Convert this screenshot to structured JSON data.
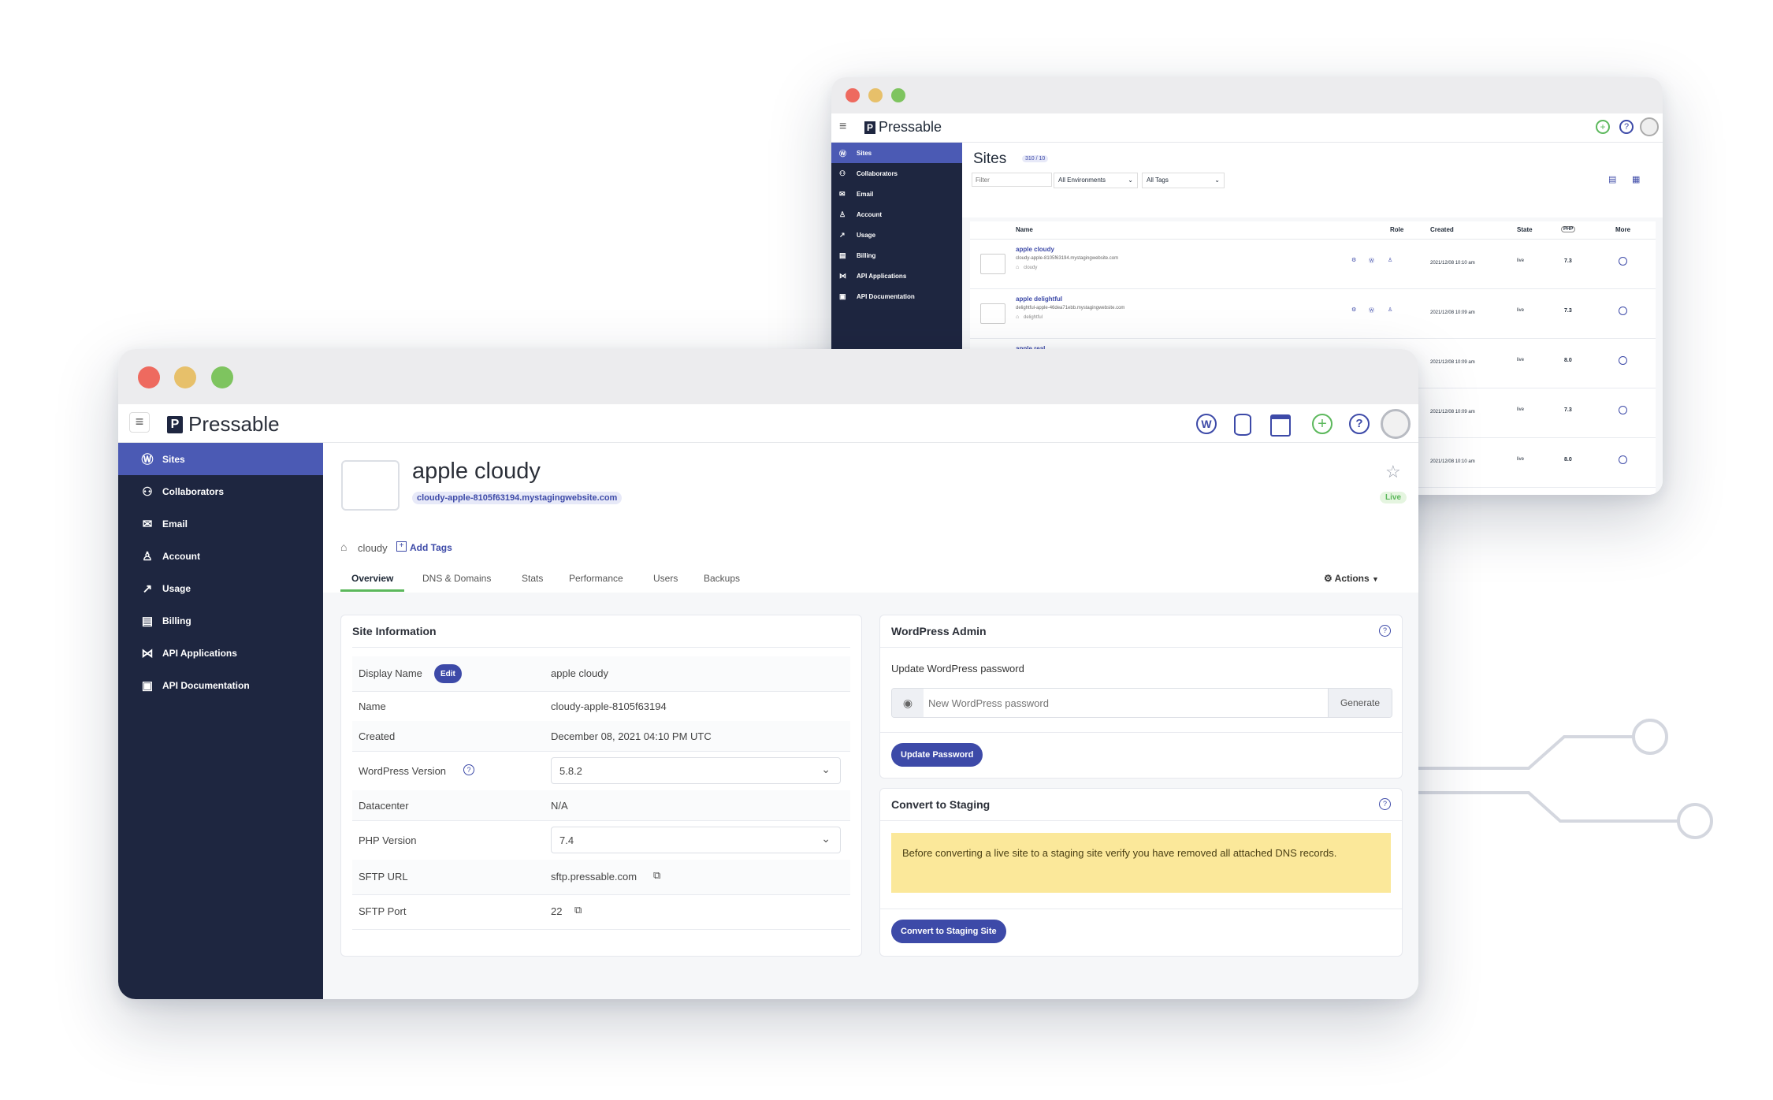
{
  "back_window": {
    "brand": "Pressable",
    "nav": [
      "Sites",
      "Collaborators",
      "Email",
      "Account",
      "Usage",
      "Billing",
      "API Applications",
      "API Documentation"
    ],
    "page_title": "Sites",
    "count_badge": "310 / 10",
    "filter_placeholder": "Filter",
    "env_select": "All Environments",
    "tags_select": "All Tags",
    "columns": [
      "Name",
      "Role",
      "Created",
      "State",
      "PHP",
      "More"
    ],
    "rows": [
      {
        "name": "apple cloudy",
        "url": "cloudy-apple-8105f63194.mystagingwebsite.com",
        "tag": "cloudy",
        "created": "2021/12/08 10:10 am",
        "state": "live",
        "php": "7.3"
      },
      {
        "name": "apple delightful",
        "url": "delightful-apple-46dea71ebb.mystagingwebsite.com",
        "tag": "delightful",
        "created": "2021/12/08 10:09 am",
        "state": "live",
        "php": "7.3"
      },
      {
        "name": "apple real",
        "url": "",
        "tag": "",
        "created": "2021/12/08 10:09 am",
        "state": "live",
        "php": "8.0"
      },
      {
        "name": "",
        "url": "",
        "tag": "",
        "created": "2021/12/08 10:09 am",
        "state": "live",
        "php": "7.3"
      },
      {
        "name": "",
        "url": "",
        "tag": "",
        "created": "2021/12/08 10:10 am",
        "state": "live",
        "php": "8.0"
      }
    ]
  },
  "front_window": {
    "brand": "Pressable",
    "nav": [
      "Sites",
      "Collaborators",
      "Email",
      "Account",
      "Usage",
      "Billing",
      "API Applications",
      "API Documentation"
    ],
    "site_title": "apple cloudy",
    "site_url": "cloudy-apple-8105f63194.mystagingwebsite.com",
    "status": "Live",
    "tag": "cloudy",
    "add_tags": "Add Tags",
    "tabs": [
      "Overview",
      "DNS & Domains",
      "Stats",
      "Performance",
      "Users",
      "Backups"
    ],
    "actions": "Actions",
    "site_info": {
      "heading": "Site Information",
      "edit": "Edit",
      "rows": [
        {
          "label": "Display Name",
          "value": "apple cloudy"
        },
        {
          "label": "Name",
          "value": "cloudy-apple-8105f63194"
        },
        {
          "label": "Created",
          "value": "December 08, 2021 04:10 PM UTC"
        },
        {
          "label": "WordPress Version",
          "value": "5.8.2"
        },
        {
          "label": "Datacenter",
          "value": "N/A"
        },
        {
          "label": "PHP Version",
          "value": "7.4"
        },
        {
          "label": "SFTP URL",
          "value": "sftp.pressable.com"
        },
        {
          "label": "SFTP Port",
          "value": "22"
        }
      ]
    },
    "wp_admin": {
      "heading": "WordPress Admin",
      "label": "Update WordPress password",
      "placeholder": "New WordPress password",
      "generate": "Generate",
      "update_button": "Update Password"
    },
    "staging": {
      "heading": "Convert to Staging",
      "warning": "Before converting a live site to a staging site verify you have removed all attached DNS records.",
      "button": "Convert to Staging Site"
    }
  },
  "colors": {
    "sidebar": "#1e2640",
    "active": "#4b5ab4",
    "accent": "#3d4aa8",
    "green": "#5cb85c",
    "warning": "#fbe89a"
  }
}
